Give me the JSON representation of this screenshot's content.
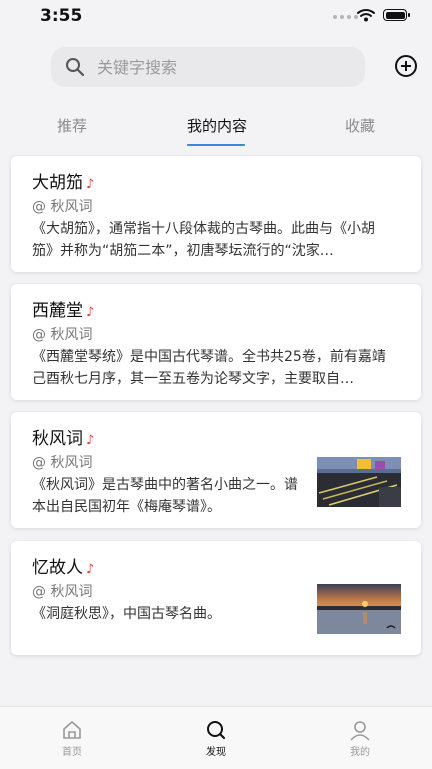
{
  "status_bar": {
    "time": "3:55"
  },
  "search": {
    "placeholder": "关键字搜索"
  },
  "tabs": [
    {
      "label": "推荐"
    },
    {
      "label": "我的内容"
    },
    {
      "label": "收藏"
    }
  ],
  "active_tab": "我的内容",
  "cards": [
    {
      "title": "大胡笳",
      "author": "@ 秋风词",
      "description": "《大胡笳》，通常指十八段体裁的古琴曲。此曲与《小胡笳》并称为“胡笳二本”，初唐琴坛流行的“沈家…"
    },
    {
      "title": "西麓堂",
      "author": "@ 秋风词",
      "description": "《西麓堂琴统》是中国古代琴谱。全书共25卷，前有嘉靖己酉秋七月序，其一至五卷为论琴文字，主要取自…"
    },
    {
      "title": "秋风词",
      "author": "@ 秋风词",
      "description": "《秋风词》是古琴曲中的著名小曲之一。谱本出自民国初年《梅庵琴谱》。"
    },
    {
      "title": "忆故人",
      "author": "@ 秋风词",
      "description": "《洞庭秋思》，中国古琴名曲。"
    }
  ],
  "bottom_nav": [
    {
      "label": "首页"
    },
    {
      "label": "发现"
    },
    {
      "label": "我的"
    }
  ],
  "active_nav": "发现",
  "colors": {
    "accent": "#3f86db",
    "note": "#e03a3a",
    "background": "#f3f3f5"
  }
}
